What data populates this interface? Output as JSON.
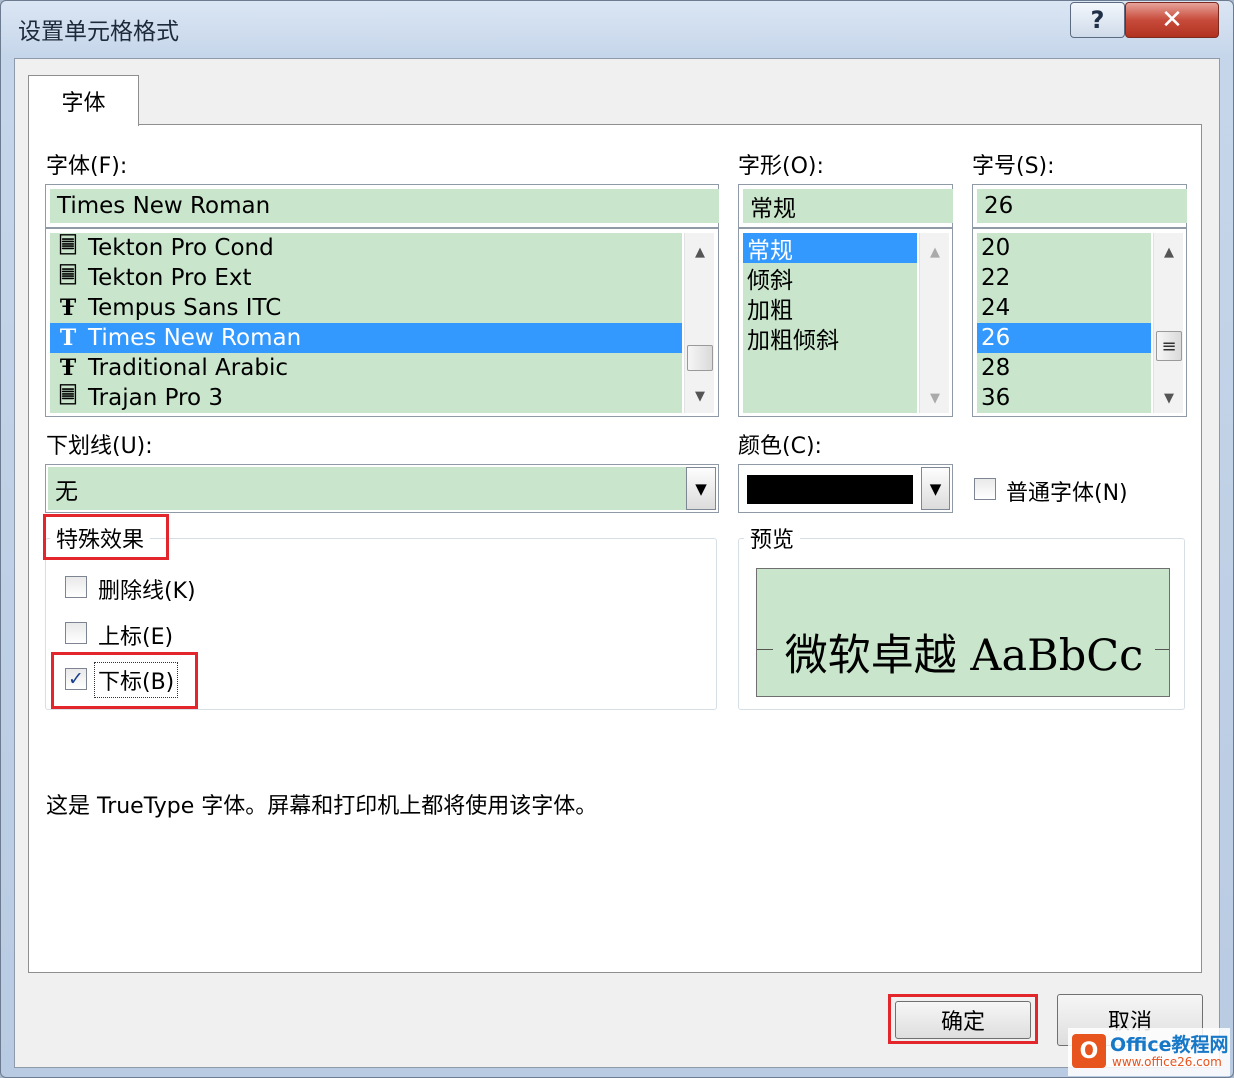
{
  "window": {
    "title": "设置单元格格式",
    "help_glyph": "?",
    "close_glyph": "✕"
  },
  "tab": {
    "label": "字体"
  },
  "font": {
    "label": "字体(F):",
    "value": "Times New Roman",
    "items": [
      {
        "name": "Tekton Pro Cond",
        "icon": "opentype-font-icon",
        "glyph": "🗏"
      },
      {
        "name": "Tekton Pro Ext",
        "icon": "opentype-font-icon",
        "glyph": "🗏"
      },
      {
        "name": "Tempus Sans ITC",
        "icon": "truetype-font-icon",
        "glyph": "Ŧ"
      },
      {
        "name": "Times New Roman",
        "icon": "truetype-font-icon",
        "glyph": "T"
      },
      {
        "name": "Traditional Arabic",
        "icon": "truetype-font-icon",
        "glyph": "Ŧ"
      },
      {
        "name": "Trajan Pro 3",
        "icon": "opentype-font-icon",
        "glyph": "🗏"
      }
    ]
  },
  "style": {
    "label": "字形(O):",
    "value": "常规",
    "items": [
      "常规",
      "倾斜",
      "加粗",
      "加粗倾斜"
    ]
  },
  "size": {
    "label": "字号(S):",
    "value": "26",
    "items": [
      "20",
      "22",
      "24",
      "26",
      "28",
      "36"
    ]
  },
  "underline": {
    "label": "下划线(U):",
    "value": "无"
  },
  "color": {
    "label": "颜色(C):",
    "swatch": "#000000"
  },
  "normal_font": {
    "label": "普通字体(N)",
    "checked": false
  },
  "effects": {
    "title": "特殊效果",
    "strikethrough": "删除线(K)",
    "superscript": "上标(E)",
    "subscript": "下标(B)",
    "check_glyph": "✓"
  },
  "preview": {
    "title": "预览",
    "sample": "微软卓越  AaBbCc"
  },
  "info": "这是 TrueType 字体。屏幕和打印机上都将使用该字体。",
  "buttons": {
    "ok": "确定",
    "cancel": "取消"
  },
  "arrows": {
    "up": "▲",
    "down": "▼",
    "grip": "≡"
  },
  "watermark": {
    "brand": "Office教程网",
    "url": "www.office26.com"
  },
  "colors": {
    "selection": "#3399ff",
    "field_bg": "#c9e6cc",
    "highlight": "#e3262b"
  }
}
